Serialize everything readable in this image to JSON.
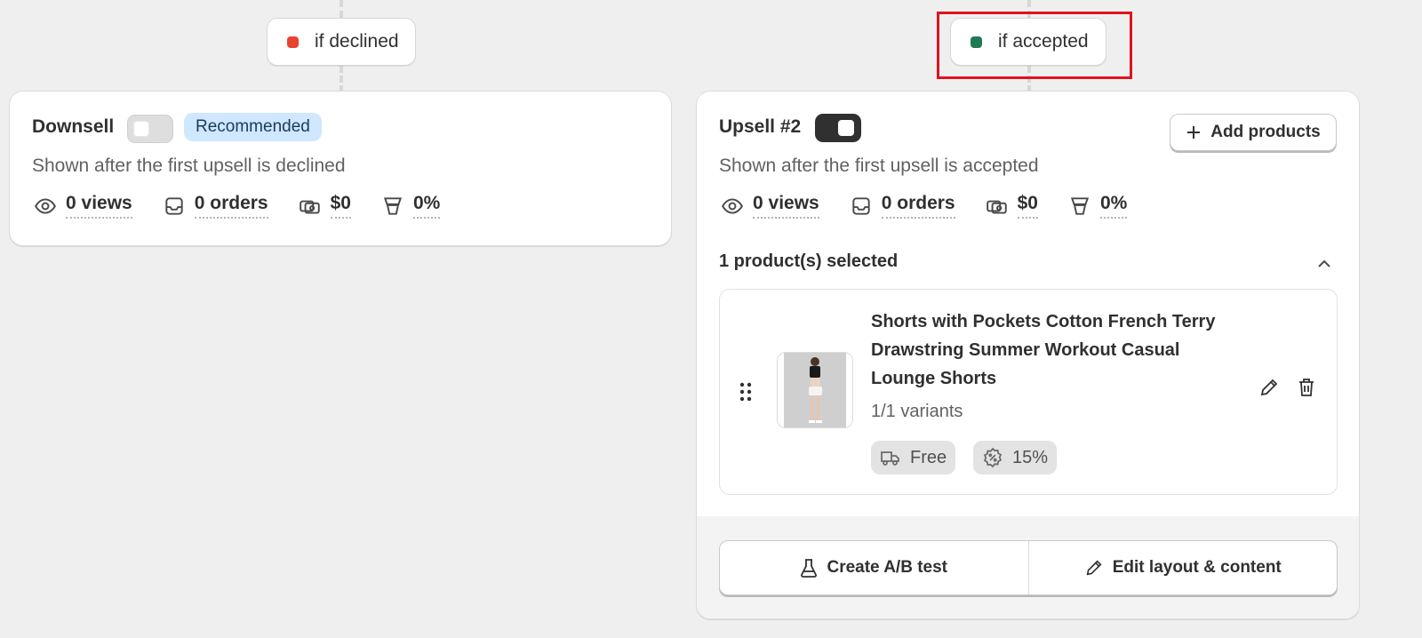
{
  "branches": {
    "declined": {
      "label": "if declined",
      "dot_color": "#e8432e"
    },
    "accepted": {
      "label": "if accepted",
      "dot_color": "#1f7a52"
    }
  },
  "downsell": {
    "title": "Downsell",
    "toggle_on": false,
    "badge": "Recommended",
    "subtitle": "Shown after the first upsell is declined",
    "stats": {
      "views": "0 views",
      "orders": "0 orders",
      "revenue": "$0",
      "conversion": "0%"
    }
  },
  "upsell": {
    "title": "Upsell #2",
    "toggle_on": true,
    "add_products_label": "Add products",
    "subtitle": "Shown after the first upsell is accepted",
    "stats": {
      "views": "0 views",
      "orders": "0 orders",
      "revenue": "$0",
      "conversion": "0%"
    },
    "selected_label": "1 product(s) selected",
    "products": [
      {
        "name": "Shorts with Pockets Cotton French Terry Drawstring Summer Workout Casual Lounge Shorts",
        "variants": "1/1 variants",
        "shipping": "Free",
        "discount": "15%"
      }
    ],
    "ab_test_label": "Create A/B test",
    "edit_layout_label": "Edit layout & content"
  }
}
